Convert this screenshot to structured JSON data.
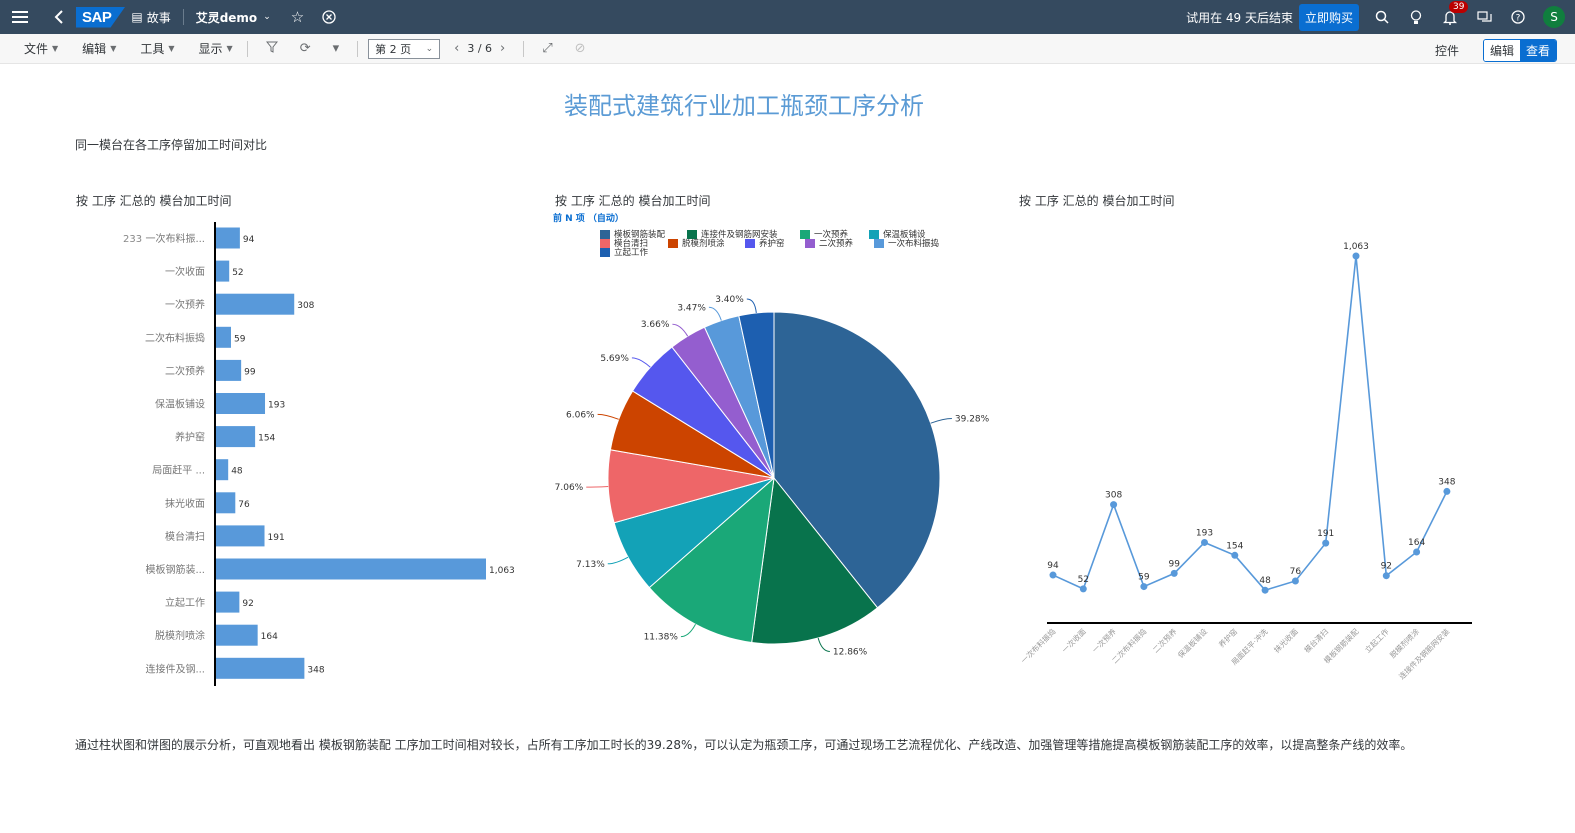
{
  "shellbar": {
    "logo": "SAP",
    "story_label": "故事",
    "app_name": "艾灵demo",
    "trial_text": "试用在 49 天后结束",
    "buy_label": "立即购买",
    "notif_count": "39",
    "avatar_initial": "S"
  },
  "toolbar": {
    "menus": [
      {
        "label": "文件"
      },
      {
        "label": "编辑"
      },
      {
        "label": "工具"
      },
      {
        "label": "显示"
      }
    ],
    "page_value": "第 2 页",
    "pager_text": "3 / 6",
    "controls_label": "控件",
    "edit_label": "编辑",
    "view_label": "查看"
  },
  "page": {
    "title": "装配式建筑行业加工瓶颈工序分析",
    "subtitle": "同一模台在各工序停留加工时间对比",
    "footer": "通过柱状图和饼图的展示分析，可直观地看出 模板钢筋装配 工序加工时间相对较长，占所有工序加工时长的39.28%，可以认定为瓶颈工序，可通过现场工艺流程优化、产线改造、加强管理等措施提高模板钢筋装配工序的效率，以提高整条产线的效率。"
  },
  "chart_data": [
    {
      "type": "bar",
      "title": "按 工序 汇总的 模台加工时间",
      "orientation": "horizontal",
      "extra_label": "233",
      "categories": [
        "一次布料振...",
        "一次收面",
        "一次预养",
        "二次布料振捣",
        "二次预养",
        "保温板铺设",
        "养护窑",
        "局面赶平 ...",
        "抹光收面",
        "模台清扫",
        "模板钢筋装...",
        "立起工作",
        "脱模剂喷涂",
        "连接件及钢..."
      ],
      "values": [
        94,
        52,
        308,
        59,
        99,
        193,
        154,
        48,
        76,
        191,
        1063,
        92,
        164,
        348
      ],
      "value_labels": [
        "94",
        "52",
        "308",
        "59",
        "99",
        "193",
        "154",
        "48",
        "76",
        "191",
        "1,063",
        "92",
        "164",
        "348"
      ],
      "color": "#5899da"
    },
    {
      "type": "pie",
      "title": "按 工序 汇总的 模台加工时间",
      "topn_label": "前 N 项 （自动）",
      "legend": [
        {
          "label": "模板钢筋装配",
          "color": "#2d6496"
        },
        {
          "label": "连接件及钢筋网安装",
          "color": "#08734c"
        },
        {
          "label": "一次预养",
          "color": "#1aa878"
        },
        {
          "label": "保温板铺设",
          "color": "#13a2b7"
        },
        {
          "label": "模台清扫",
          "color": "#ee6668"
        },
        {
          "label": "脱模剂喷涂",
          "color": "#cc4400"
        },
        {
          "label": "养护窑",
          "color": "#5557ee"
        },
        {
          "label": "二次预养",
          "color": "#945ecf"
        },
        {
          "label": "一次布料振捣",
          "color": "#5899da"
        },
        {
          "label": "立起工作",
          "color": "#1d5fb0"
        }
      ],
      "slices": [
        {
          "label": "模板钢筋装配",
          "value": 39.28,
          "text": "39.28%",
          "color": "#2d6496"
        },
        {
          "label": "连接件及钢筋网安装",
          "value": 12.86,
          "text": "12.86%",
          "color": "#08734c"
        },
        {
          "label": "一次预养",
          "value": 11.38,
          "text": "11.38%",
          "color": "#1aa878"
        },
        {
          "label": "保温板铺设",
          "value": 7.13,
          "text": "7.13%",
          "color": "#13a2b7"
        },
        {
          "label": "模台清扫",
          "value": 7.06,
          "text": "7.06%",
          "color": "#ee6668"
        },
        {
          "label": "脱模剂喷涂",
          "value": 6.06,
          "text": "6.06%",
          "color": "#cc4400"
        },
        {
          "label": "养护窑",
          "value": 5.69,
          "text": "5.69%",
          "color": "#5557ee"
        },
        {
          "label": "二次预养",
          "value": 3.66,
          "text": "3.66%",
          "color": "#945ecf"
        },
        {
          "label": "一次布料振捣",
          "value": 3.47,
          "text": "3.47%",
          "color": "#5899da"
        },
        {
          "label": "立起工作",
          "value": 3.4,
          "text": "3.40%",
          "color": "#1d5fb0"
        }
      ]
    },
    {
      "type": "line",
      "title": "按 工序 汇总的 模台加工时间",
      "categories": [
        "一次布料振捣",
        "一次收面",
        "一次预养",
        "二次布料振捣",
        "二次预养",
        "保温板铺设",
        "养护窑",
        "局面赶平·冲洗",
        "抹光收面",
        "模台清扫",
        "模板钢筋装配",
        "立起工作",
        "脱模剂喷涂",
        "连接件及钢筋网安装"
      ],
      "values": [
        94,
        52,
        308,
        59,
        99,
        193,
        154,
        48,
        76,
        191,
        1063,
        92,
        164,
        348
      ],
      "value_labels": [
        "94",
        "52",
        "308",
        "59",
        "99",
        "193",
        "154",
        "48",
        "76",
        "191",
        "1,063",
        "92",
        "164",
        "348"
      ],
      "color": "#5899da"
    }
  ]
}
